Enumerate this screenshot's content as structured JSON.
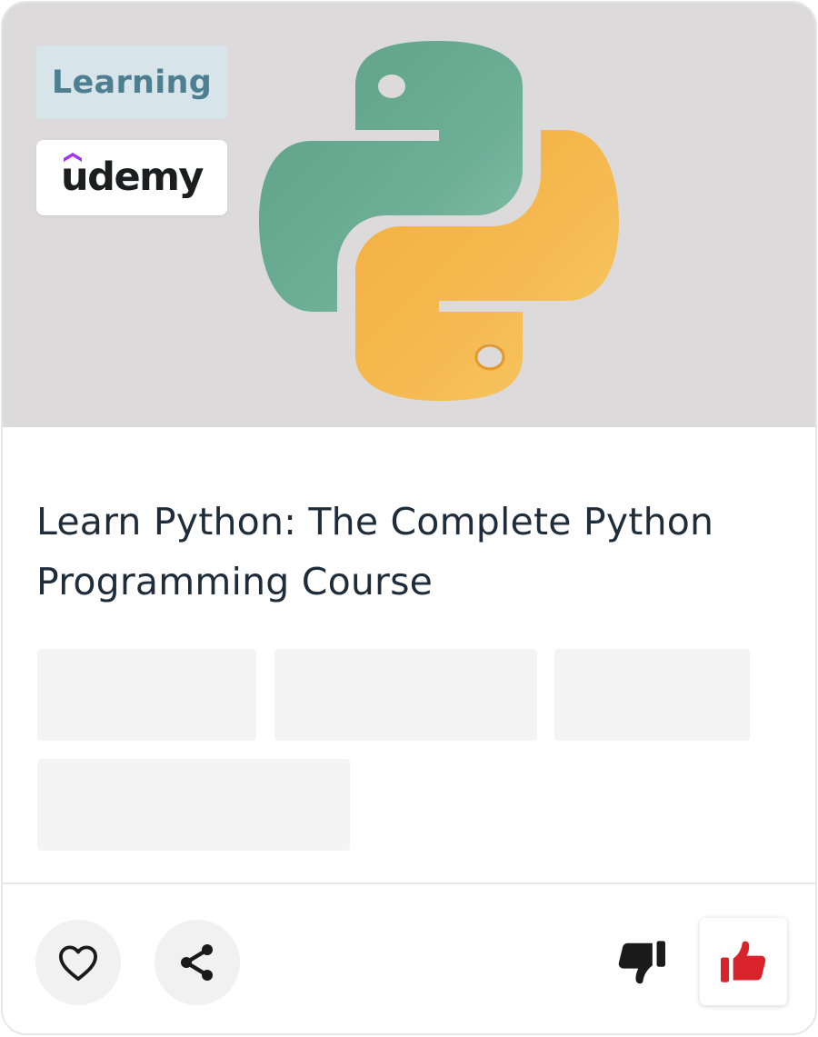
{
  "card": {
    "category_badge": "Learning",
    "provider": {
      "name": "udemy",
      "logo_icon": "udemy-logo"
    },
    "hero_image": {
      "icon": "python-logo",
      "colors": {
        "top_snake": "#6aae96",
        "bottom_snake": "#f4b84e",
        "background": "#dcdadb"
      }
    },
    "title": "Learn Python: The Complete Python Programming Course"
  },
  "actions": {
    "favorite_icon": "heart-icon",
    "share_icon": "share-icon",
    "dislike_icon": "thumbs-down-icon",
    "like_icon": "thumbs-up-icon",
    "like_color": "#d8232a",
    "dislike_color": "#1a1a1a"
  }
}
